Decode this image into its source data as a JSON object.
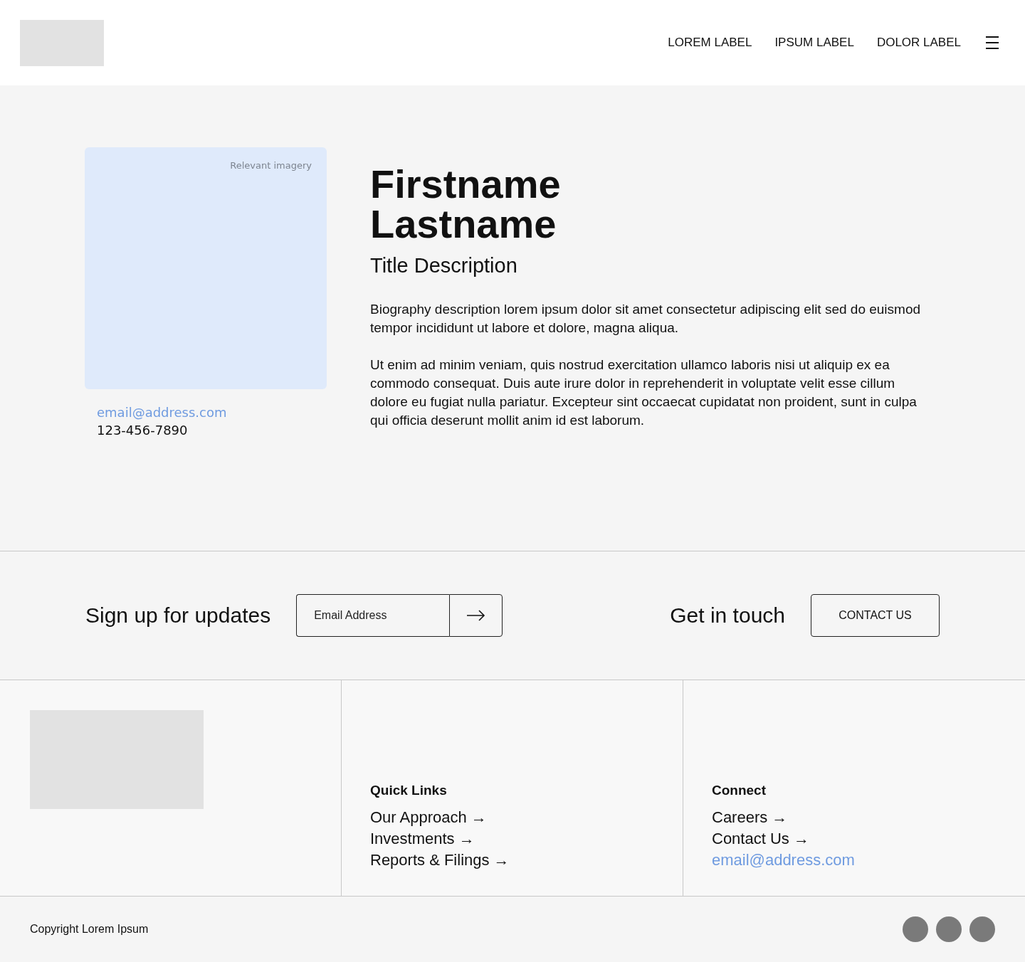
{
  "header": {
    "nav": [
      "LOREM LABEL",
      "IPSUM LABEL",
      "DOLOR LABEL"
    ]
  },
  "profile": {
    "image_caption": "Relevant imagery",
    "email": "email@address.com",
    "phone": "123-456-7890",
    "name_lines": [
      "Firstname",
      "Lastname"
    ],
    "title": "Title Description",
    "bio": [
      "Biography description lorem ipsum dolor sit amet consectetur adipiscing elit sed do euismod tempor incididunt ut labore et dolore, magna aliqua.",
      "Ut enim ad minim veniam, quis nostrud exercitation ullamco laboris nisi ut aliquip ex ea commodo consequat. Duis aute irure dolor in reprehenderit in voluptate velit esse cillum dolore eu fugiat nulla pariatur. Excepteur sint occaecat cupidatat non proident, sunt in culpa qui officia deserunt mollit anim id est laborum."
    ]
  },
  "signup": {
    "heading": "Sign up for updates",
    "placeholder": "Email Address",
    "contact_heading": "Get in touch",
    "contact_button": "CONTACT US"
  },
  "footer": {
    "columns": [
      {
        "heading": "Quick Links",
        "links": [
          {
            "label": "Our Approach →",
            "kind": "page"
          },
          {
            "label": "Investments →",
            "kind": "page"
          },
          {
            "label": "Reports & Filings →",
            "kind": "page"
          }
        ]
      },
      {
        "heading": "Connect",
        "links": [
          {
            "label": "Careers →",
            "kind": "page"
          },
          {
            "label": "Contact Us →",
            "kind": "page"
          },
          {
            "label": "email@address.com",
            "kind": "email"
          }
        ]
      }
    ],
    "copyright": "Copyright Lorem Ipsum"
  }
}
